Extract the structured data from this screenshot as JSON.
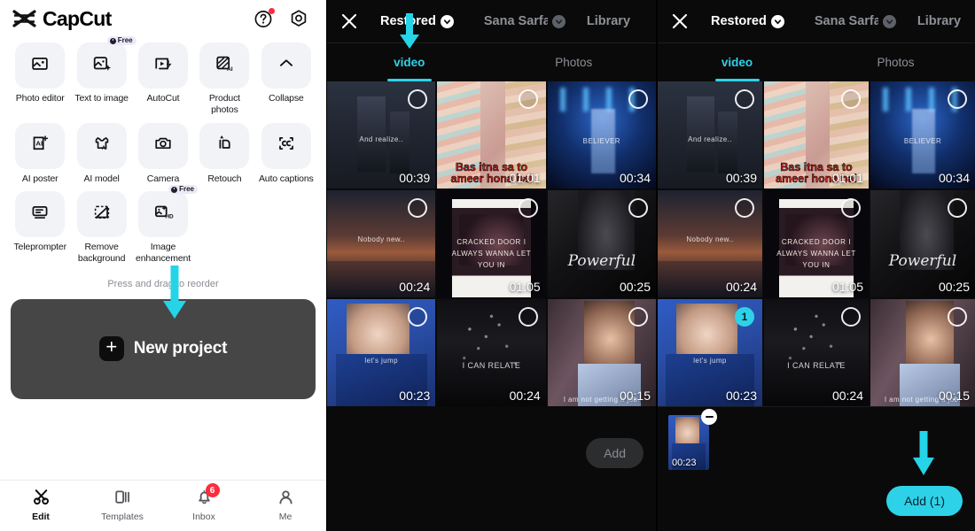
{
  "left": {
    "brand": "CapCut",
    "header_icons": [
      {
        "name": "help-icon",
        "label": "Help",
        "badge": true
      },
      {
        "name": "settings-icon",
        "label": "Settings",
        "badge": false
      }
    ],
    "tools": [
      {
        "label": "Photo editor",
        "icon": "photo-editor-icon",
        "free": false
      },
      {
        "label": "Text to image",
        "icon": "text-to-image-icon",
        "free": true,
        "free_label": "Free"
      },
      {
        "label": "AutoCut",
        "icon": "autocut-icon",
        "free": false
      },
      {
        "label": "Product photos",
        "icon": "product-photos-icon",
        "free": false
      },
      {
        "label": "Collapse",
        "icon": "chevron-up-icon",
        "free": false
      },
      {
        "label": "AI poster",
        "icon": "ai-poster-icon",
        "free": false
      },
      {
        "label": "AI model",
        "icon": "ai-model-icon",
        "free": false
      },
      {
        "label": "Camera",
        "icon": "camera-icon",
        "free": false
      },
      {
        "label": "Retouch",
        "icon": "retouch-icon",
        "free": false
      },
      {
        "label": "Auto captions",
        "icon": "auto-captions-icon",
        "free": false
      },
      {
        "label": "Teleprompter",
        "icon": "teleprompter-icon",
        "free": false
      },
      {
        "label": "Remove background",
        "icon": "remove-background-icon",
        "free": false
      },
      {
        "label": "Image enhancement",
        "icon": "image-enhancement-icon",
        "free": true,
        "free_label": "Free"
      }
    ],
    "reorder_hint": "Press and drag to reorder",
    "new_project": {
      "label": "New project",
      "plus": "+"
    },
    "bottom_nav": [
      {
        "label": "Edit",
        "icon": "scissors-icon",
        "active": true,
        "badge": null
      },
      {
        "label": "Templates",
        "icon": "templates-icon",
        "active": false,
        "badge": null
      },
      {
        "label": "Inbox",
        "icon": "bell-icon",
        "active": false,
        "badge": "6"
      },
      {
        "label": "Me",
        "icon": "person-icon",
        "active": false,
        "badge": null
      }
    ]
  },
  "picker_mid": {
    "close_icon": "close-icon",
    "titles": [
      {
        "text": "Restored",
        "active": true,
        "chevron": "chevron-down-icon",
        "chevron_style": "light"
      },
      {
        "text": "Sana Sarfaraz",
        "active": false,
        "chevron": "chevron-down-icon",
        "chevron_style": "dim"
      },
      {
        "text": "Library",
        "active": false,
        "chevron": null
      }
    ],
    "tabs": [
      {
        "label": "video",
        "active": true
      },
      {
        "label": "Photos",
        "active": false
      }
    ],
    "media": [
      {
        "duration": "00:39",
        "art": "t-city",
        "caption": "And realize..",
        "selected": false
      },
      {
        "duration": "01:01",
        "art": "t-guy",
        "caption": "Bas itna sa to ameer hona hai",
        "selected": false
      },
      {
        "duration": "00:34",
        "art": "t-stage",
        "caption": "BELIEVER",
        "selected": false
      },
      {
        "duration": "00:24",
        "art": "t-sunset",
        "caption": "Nobody new..",
        "selected": false
      },
      {
        "duration": "01:05",
        "art": "t-post",
        "caption": "CRACKED DOOR I ALWAYS WANNA LET YOU IN",
        "selected": false
      },
      {
        "duration": "00:25",
        "art": "t-dark",
        "caption": "Powerful",
        "selected": false
      },
      {
        "duration": "00:23",
        "art": "t-singer",
        "caption": "let's jump",
        "selected": false
      },
      {
        "duration": "00:24",
        "art": "t-street",
        "caption": "I CAN RELATE",
        "selected": false
      },
      {
        "duration": "00:15",
        "art": "t-girl",
        "caption": "I am not getting a job.",
        "selected": false
      }
    ],
    "tray_items": [],
    "add_button": {
      "label": "Add",
      "enabled": false
    }
  },
  "picker_right": {
    "close_icon": "close-icon",
    "titles": [
      {
        "text": "Restored",
        "active": true,
        "chevron": "chevron-down-icon",
        "chevron_style": "light"
      },
      {
        "text": "Sana Sarfaraz",
        "active": false,
        "chevron": "chevron-down-icon",
        "chevron_style": "dim"
      },
      {
        "text": "Library",
        "active": false,
        "chevron": null
      }
    ],
    "tabs": [
      {
        "label": "video",
        "active": true
      },
      {
        "label": "Photos",
        "active": false
      }
    ],
    "media": [
      {
        "duration": "00:39",
        "art": "t-city",
        "caption": "And realize..",
        "selected": false
      },
      {
        "duration": "01:01",
        "art": "t-guy",
        "caption": "Bas itna sa to ameer hona hai",
        "selected": false
      },
      {
        "duration": "00:34",
        "art": "t-stage",
        "caption": "BELIEVER",
        "selected": false
      },
      {
        "duration": "00:24",
        "art": "t-sunset",
        "caption": "Nobody new..",
        "selected": false
      },
      {
        "duration": "01:05",
        "art": "t-post",
        "caption": "CRACKED DOOR I ALWAYS WANNA LET YOU IN",
        "selected": false
      },
      {
        "duration": "00:25",
        "art": "t-dark",
        "caption": "Powerful",
        "selected": false
      },
      {
        "duration": "00:23",
        "art": "t-singer",
        "caption": "let's jump",
        "selected": true,
        "select_index": "1"
      },
      {
        "duration": "00:24",
        "art": "t-street",
        "caption": "I CAN RELATE",
        "selected": false
      },
      {
        "duration": "00:15",
        "art": "t-girl",
        "caption": "I am not getting a job.",
        "selected": false
      }
    ],
    "tray_items": [
      {
        "duration": "00:23",
        "art": "t-singer",
        "remove_icon": "remove-icon"
      }
    ],
    "add_button": {
      "label": "Add (1)",
      "enabled": true
    }
  },
  "colors": {
    "accent_cyan": "#2ed2e8",
    "badge_red": "#ff2c3e",
    "panel_dark": "#0a0a0a",
    "tile_grey": "#f1f3f7",
    "new_project_grey": "#464646"
  },
  "annotations": [
    {
      "name": "arrow-new-project",
      "target": "new-project-button"
    },
    {
      "name": "arrow-video-tab-mid",
      "target": "tab-video"
    },
    {
      "name": "arrow-add-button-right",
      "target": "add-button"
    }
  ]
}
